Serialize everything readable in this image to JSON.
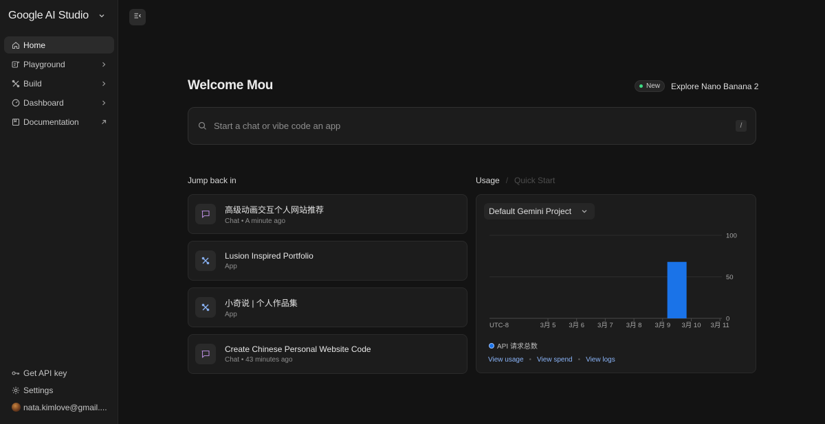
{
  "sidebar": {
    "brand": "Google AI Studio",
    "items": [
      {
        "label": "Home",
        "icon": "home-icon",
        "active": true
      },
      {
        "label": "Playground",
        "icon": "playground-icon"
      },
      {
        "label": "Build",
        "icon": "build-icon"
      },
      {
        "label": "Dashboard",
        "icon": "dashboard-icon"
      },
      {
        "label": "Documentation",
        "icon": "documentation-icon"
      }
    ],
    "bottom": {
      "api_key": "Get API key",
      "settings": "Settings",
      "account": "nata.kimlove@gmail...."
    }
  },
  "main": {
    "welcome": "Welcome Mou",
    "new_badge": "New",
    "explore": "Explore Nano Banana 2",
    "search": {
      "placeholder": "Start a chat or vibe code an app",
      "shortcut": "/"
    },
    "jump_back_title": "Jump back in",
    "recent": [
      {
        "title": "高级动画交互个人网站推荐",
        "subtitle": "Chat • A minute ago",
        "type": "chat"
      },
      {
        "title": "Lusion Inspired Portfolio",
        "subtitle": "App",
        "type": "app"
      },
      {
        "title": "小奇说 | 个人作品集",
        "subtitle": "App",
        "type": "app"
      },
      {
        "title": "Create Chinese Personal Website Code",
        "subtitle": "Chat • 43 minutes ago",
        "type": "chat"
      }
    ],
    "usage": {
      "tab_usage": "Usage",
      "tab_quick_start": "Quick Start",
      "project": "Default Gemini Project",
      "legend": "API 请求总数",
      "links": {
        "view_usage": "View usage",
        "view_spend": "View spend",
        "view_logs": "View logs"
      },
      "separator": "•"
    }
  },
  "chart_data": {
    "type": "bar",
    "categories": [
      "3月 5",
      "3月 6",
      "3月 7",
      "3月 8",
      "3月 9",
      "3月 10",
      "3月 11"
    ],
    "x_axis_prefix": "UTC-8",
    "y_ticks": [
      "100",
      "50",
      "0"
    ],
    "ylim": [
      0,
      100
    ],
    "series": [
      {
        "name": "API 请求总数",
        "values": [
          0,
          0,
          0,
          0,
          68,
          0,
          0
        ]
      }
    ],
    "bar_color": "#1a73e8",
    "grid": true
  }
}
